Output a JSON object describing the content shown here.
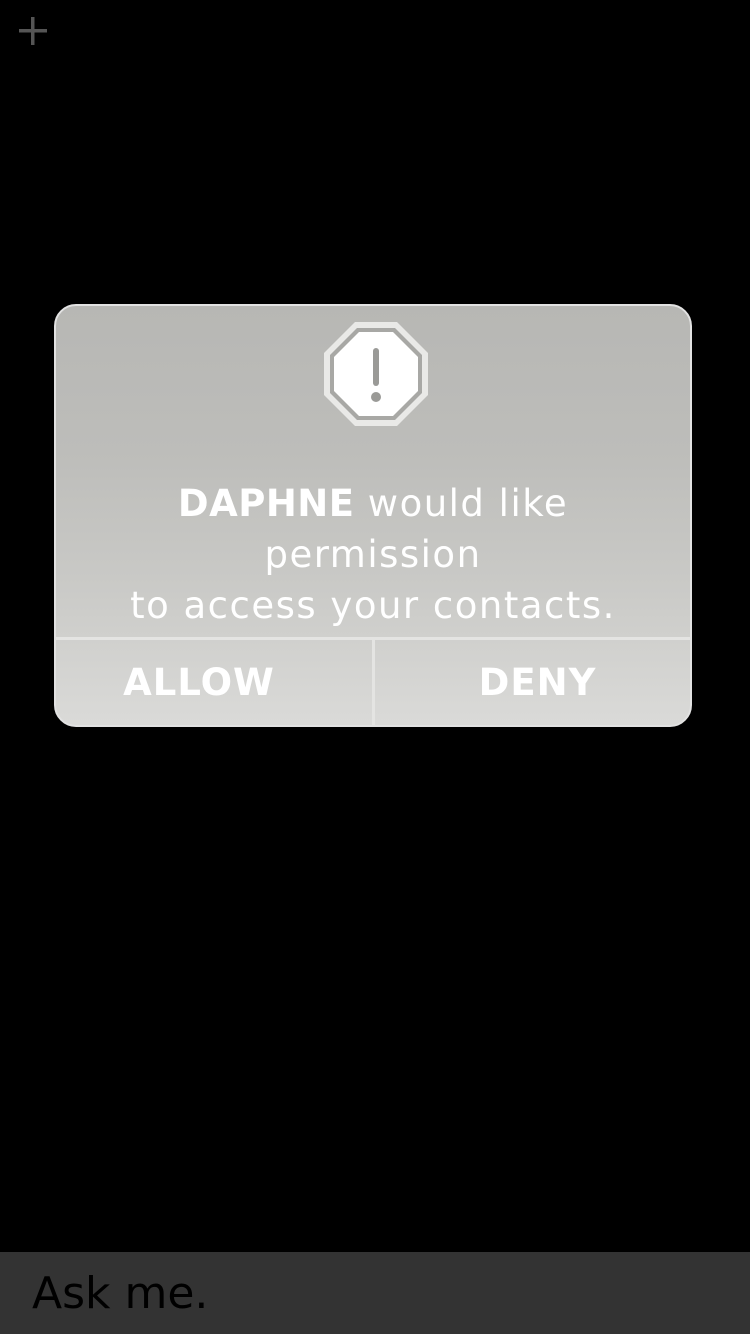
{
  "top_bar": {
    "add_icon": "plus-icon",
    "add_icon_color": "#555555"
  },
  "dialog": {
    "icon": "alert-octagon-icon",
    "app_name": "DAPHNE",
    "message_line1_rest": " would like permission",
    "message_line2": "to access your contacts.",
    "allow_label": "ALLOW",
    "deny_label": "DENY",
    "text_color": "#ffffff"
  },
  "bottom_bar": {
    "input_placeholder": "Ask me.",
    "background_color": "#333333"
  }
}
